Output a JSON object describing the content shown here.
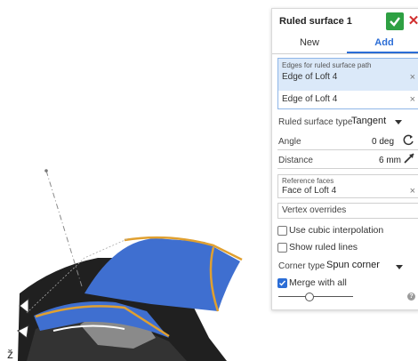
{
  "viewport": {
    "corner_glyph": "ž"
  },
  "panel": {
    "title": "Ruled surface 1",
    "tabs": [
      {
        "label": "New"
      },
      {
        "label": "Add"
      }
    ],
    "edges": {
      "label": "Edges for ruled surface path",
      "items": [
        "Edge of Loft 4",
        "Edge of Loft 4"
      ]
    },
    "ruled_surface_type": {
      "label": "Ruled surface type",
      "value": "Tangent"
    },
    "angle": {
      "label": "Angle",
      "value": "0 deg"
    },
    "distance": {
      "label": "Distance",
      "value": "6 mm"
    },
    "reference_faces": {
      "label": "Reference faces",
      "items": [
        "Face of Loft 4"
      ]
    },
    "vertex_overrides": "Vertex overrides",
    "use_cubic": {
      "label": "Use cubic interpolation",
      "checked": false
    },
    "show_ruled_lines": {
      "label": "Show ruled lines",
      "checked": false
    },
    "corner_type": {
      "label": "Corner type",
      "value": "Spun corner"
    },
    "merge_with_all": {
      "label": "Merge with all",
      "checked": true
    },
    "help": "?"
  },
  "colors": {
    "accent": "#2b6dd6",
    "confirm": "#2ea043",
    "cancel": "#d12f2f",
    "surface": "#3f6fd0",
    "edge_highlight": "#e0a030"
  }
}
